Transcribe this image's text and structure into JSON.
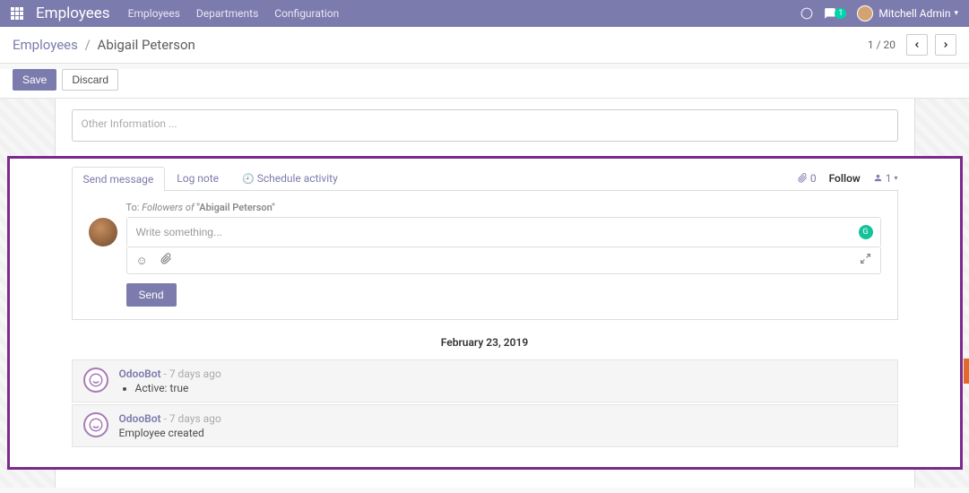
{
  "navbar": {
    "brand": "Employees",
    "links": [
      "Employees",
      "Departments",
      "Configuration"
    ],
    "msg_badge": "1",
    "user_name": "Mitchell Admin"
  },
  "breadcrumb": {
    "root": "Employees",
    "current": "Abigail Peterson"
  },
  "buttons": {
    "save": "Save",
    "discard": "Discard"
  },
  "pager": "1 / 20",
  "form": {
    "other_info_placeholder": "Other Information ..."
  },
  "chatter": {
    "tabs": {
      "send_message": "Send message",
      "log_note": "Log note",
      "schedule_activity": "Schedule activity"
    },
    "attach_count": "0",
    "follow_label": "Follow",
    "follower_count": "1",
    "composer": {
      "to_label": "To:",
      "to_followers": "Followers of",
      "to_name": "\"Abigail Peterson\"",
      "placeholder": "Write something...",
      "send_label": "Send"
    },
    "date_separator": "February 23, 2019",
    "messages": [
      {
        "author": "OdooBot",
        "time": "- 7 days ago",
        "bullet": "Active: true"
      },
      {
        "author": "OdooBot",
        "time": "- 7 days ago",
        "text": "Employee created"
      }
    ]
  }
}
